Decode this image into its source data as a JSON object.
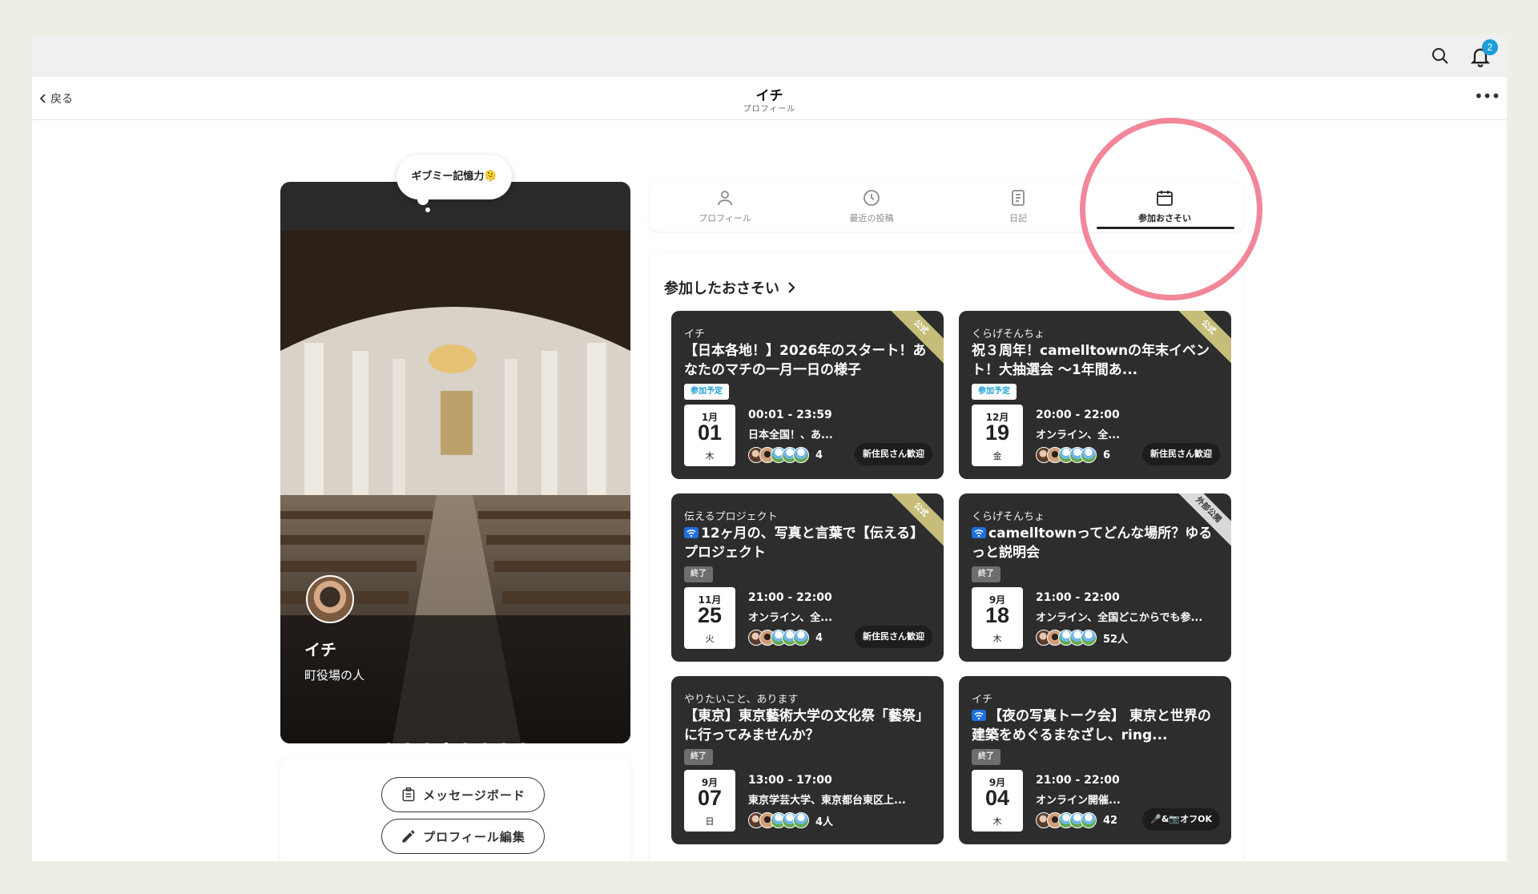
{
  "header": {
    "notification_count": "2",
    "back_label": "戻る",
    "title": "イチ",
    "subtitle": "プロフィール"
  },
  "profile": {
    "speech_bubble": "ギブミー記憶力🫠",
    "name": "イチ",
    "role": "町役場の人",
    "carousel": {
      "total": 8,
      "active_index": 3
    }
  },
  "actions": {
    "message_board": "メッセージボード",
    "edit_profile": "プロフィール編集"
  },
  "tabs": [
    {
      "label": "プロフィール",
      "icon": "person-icon",
      "active": false
    },
    {
      "label": "最近の投稿",
      "icon": "clock-icon",
      "active": false
    },
    {
      "label": "日記",
      "icon": "diary-icon",
      "active": false
    },
    {
      "label": "参加おさそい",
      "icon": "calendar-icon",
      "active": true
    }
  ],
  "section_title": "参加したおさそい",
  "events": [
    {
      "org": "イチ",
      "title": "【日本各地！】2026年のスタート！あなたのマチの一月一日の様子",
      "online": false,
      "status": "参加予定",
      "month": "1月",
      "day": "01",
      "weekday": "木",
      "time": "00:01 - 23:59",
      "place": "日本全国！、あ...",
      "count": "4",
      "tag": "新住民さん歓迎",
      "ribbon": "公式"
    },
    {
      "org": "くらげそんちょ",
      "title": "祝３周年！camelltownの年末イベント！大抽選会 〜1年間あ...",
      "online": false,
      "status": "参加予定",
      "month": "12月",
      "day": "19",
      "weekday": "金",
      "time": "20:00 - 22:00",
      "place": "オンライン、全...",
      "count": "6",
      "tag": "新住民さん歓迎",
      "ribbon": "公式"
    },
    {
      "org": "伝えるプロジェクト",
      "title": "12ヶ月の、写真と言葉で【伝える】プロジェクト",
      "online": true,
      "status": "終了",
      "month": "11月",
      "day": "25",
      "weekday": "火",
      "time": "21:00 - 22:00",
      "place": "オンライン、全...",
      "count": "4",
      "tag": "新住民さん歓迎",
      "ribbon": "公式"
    },
    {
      "org": "くらげそんちょ",
      "title": "camelltownってどんな場所？ゆるっと説明会",
      "online": true,
      "status": "終了",
      "month": "9月",
      "day": "18",
      "weekday": "木",
      "time": "21:00 - 22:00",
      "place": "オンライン、全国どこからでも参...",
      "count": "52人",
      "tag": "",
      "ribbon": "外部公開"
    },
    {
      "org": "やりたいこと、あります",
      "title": "【東京】東京藝術大学の文化祭「藝祭」に行ってみませんか？",
      "online": false,
      "status": "終了",
      "month": "9月",
      "day": "07",
      "weekday": "日",
      "time": "13:00 - 17:00",
      "place": "東京学芸大学、東京都台東区上...",
      "count": "4人",
      "tag": "",
      "ribbon": ""
    },
    {
      "org": "イチ",
      "title": "【夜の写真トーク会】 東京と世界の建築をめぐるまなざし、ring...",
      "online": true,
      "status": "終了",
      "month": "9月",
      "day": "04",
      "weekday": "木",
      "time": "21:00 - 22:00",
      "place": "オンライン開催...",
      "count": "42",
      "tag": "🎤&📷オフOK",
      "ribbon": ""
    }
  ]
}
